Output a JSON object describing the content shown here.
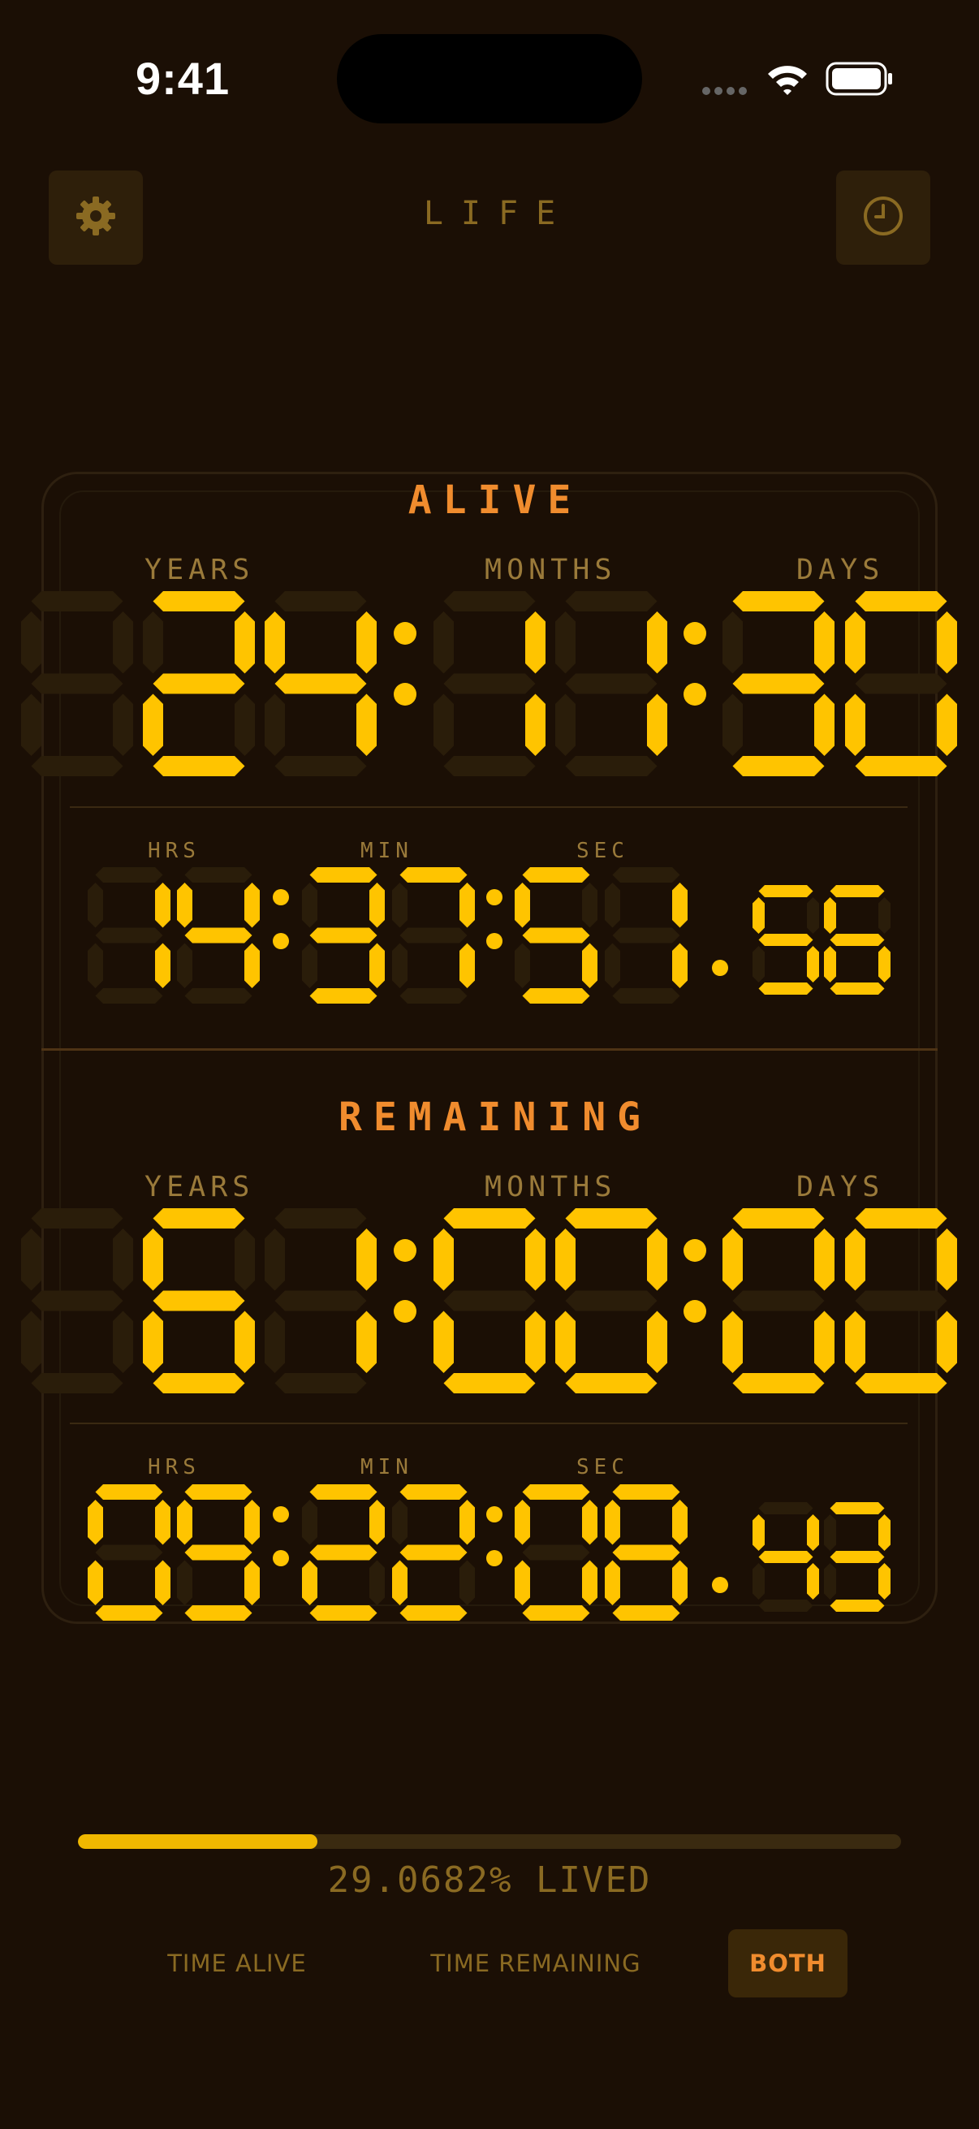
{
  "status_bar": {
    "time": "9:41"
  },
  "header": {
    "title": "LIFE",
    "settings_icon": "gear-icon",
    "history_icon": "clock-icon"
  },
  "alive": {
    "title": "ALIVE",
    "labels": {
      "years": "YEARS",
      "months": "MONTHS",
      "days": "DAYS"
    },
    "years": "24",
    "months": "11",
    "days": "30",
    "small_labels": {
      "hrs": "HRS",
      "min": "MIN",
      "sec": "SEC"
    },
    "hours": "14",
    "minutes": "37",
    "seconds": "51",
    "hundredths": "56"
  },
  "remaining": {
    "title": "REMAINING",
    "labels": {
      "years": "YEARS",
      "months": "MONTHS",
      "days": "DAYS"
    },
    "years": "61",
    "months": "00",
    "days": "00",
    "small_labels": {
      "hrs": "HRS",
      "min": "MIN",
      "sec": "SEC"
    },
    "hours": "09",
    "minutes": "22",
    "seconds": "08",
    "hundredths": "43"
  },
  "progress": {
    "fraction": 0.290682,
    "label": "29.0682% LIVED"
  },
  "modes": [
    {
      "label": "TIME ALIVE",
      "active": false
    },
    {
      "label": "TIME REMAINING",
      "active": false
    },
    {
      "label": "BOTH",
      "active": true
    }
  ],
  "colors": {
    "segment_on": "#ffc400",
    "segment_off": "#2a1d0a",
    "accent": "#f08c2e",
    "background": "#1b0f05"
  }
}
